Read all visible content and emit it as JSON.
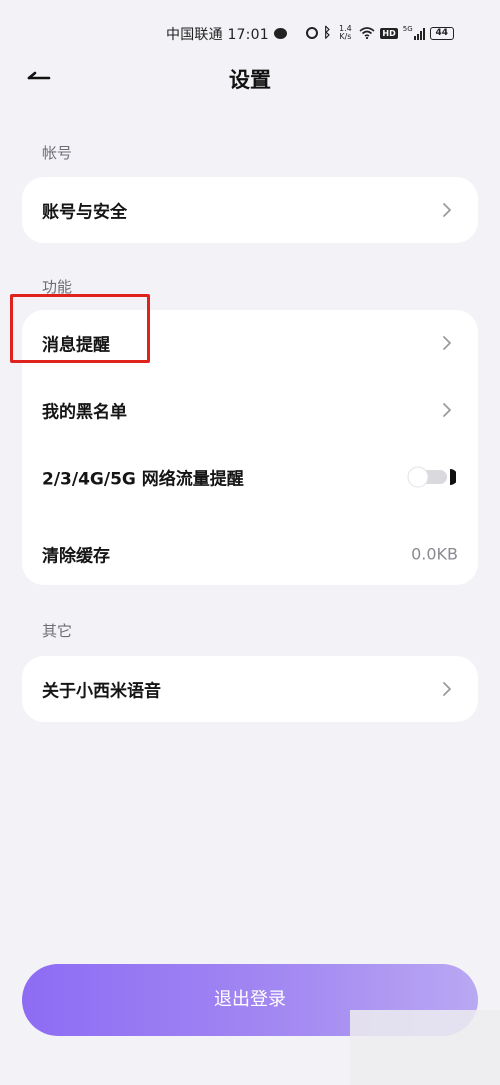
{
  "status_bar": {
    "carrier_time": "中国联通 17:01",
    "net_speed_top": "1.4",
    "net_speed_bottom": "K/s",
    "hd_label": "HD",
    "network_label": "5G",
    "battery": "44",
    "icons": [
      "chat-bubble-icon",
      "alarm-icon",
      "bluetooth-icon",
      "wifi-icon",
      "signal-icon",
      "battery-icon"
    ]
  },
  "header": {
    "back_icon": "back-arrow-icon",
    "title": "设置"
  },
  "sections": {
    "account": {
      "label": "帐号",
      "items": [
        {
          "label": "账号与安全",
          "icon": "chevron-right-icon"
        }
      ]
    },
    "features": {
      "label": "功能",
      "items": [
        {
          "label": "消息提醒",
          "icon": "chevron-right-icon"
        },
        {
          "label": "我的黑名单",
          "icon": "chevron-right-icon"
        },
        {
          "label": "2/3/4G/5G 网络流量提醒",
          "toggle": false
        },
        {
          "label": "清除缓存",
          "value": "0.0KB"
        }
      ]
    },
    "other": {
      "label": "其它",
      "items": [
        {
          "label": "关于小西米语音",
          "icon": "chevron-right-icon"
        }
      ]
    }
  },
  "logout": {
    "label": "退出登录"
  },
  "colors": {
    "background": "#f3f3f7",
    "card": "#ffffff",
    "accent_start": "#8d6cf4",
    "accent_end": "#b9a8f3",
    "highlight": "#e0221d"
  }
}
